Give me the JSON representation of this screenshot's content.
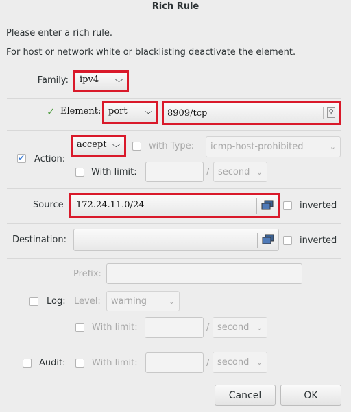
{
  "title": "Rich Rule",
  "intro": {
    "line1": "Please enter a rich rule.",
    "line2": "For host or network white or blacklisting deactivate the element."
  },
  "family": {
    "label": "Family:",
    "value": "ipv4"
  },
  "element": {
    "checked": true,
    "label": "Element:",
    "type": "port",
    "value": "8909/tcp"
  },
  "action": {
    "checked": true,
    "label": "Action:",
    "value": "accept",
    "with_type_label": "with Type:",
    "type_value": "icmp-host-prohibited",
    "with_limit_label": "With limit:",
    "limit_value": "",
    "slash": "/",
    "unit": "second"
  },
  "source": {
    "label": "Source",
    "value": "172.24.11.0/24",
    "inverted_label": "inverted"
  },
  "destination": {
    "label": "Destination:",
    "value": "",
    "inverted_label": "inverted"
  },
  "log": {
    "label": "Log:",
    "prefix_label": "Prefix:",
    "prefix_value": "",
    "level_label": "Level:",
    "level_value": "warning",
    "with_limit_label": "With limit:",
    "slash": "/",
    "unit": "second"
  },
  "audit": {
    "label": "Audit:",
    "with_limit_label": "With limit:",
    "slash": "/",
    "unit": "second"
  },
  "buttons": {
    "cancel": "Cancel",
    "ok": "OK"
  },
  "colors": {
    "highlight": "#d9192a",
    "check": "#3a7bd5"
  }
}
